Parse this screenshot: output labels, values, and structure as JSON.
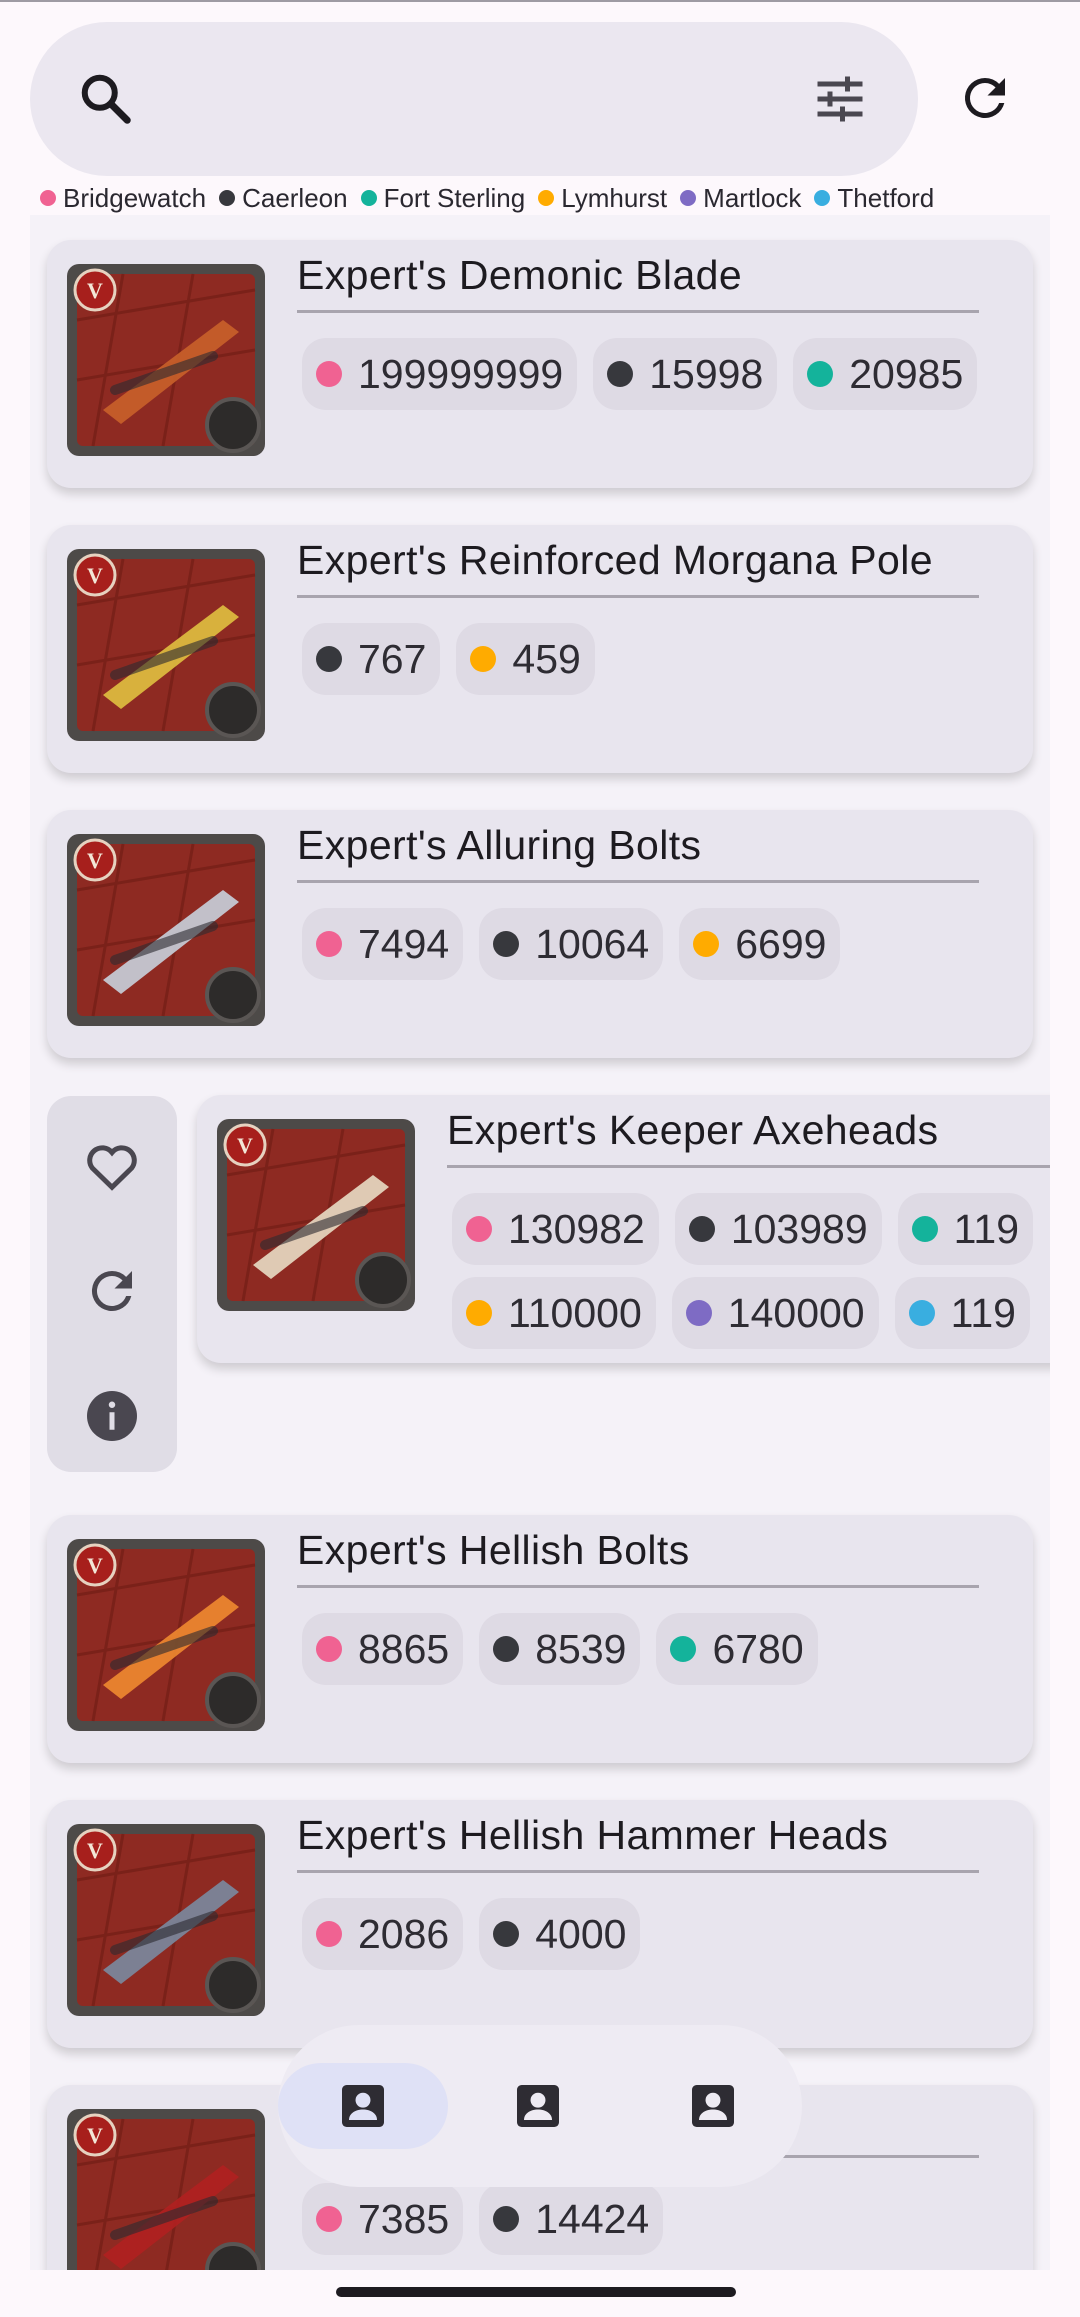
{
  "search": {
    "search_icon": "search-icon",
    "filter_icon": "tune-icon"
  },
  "header": {
    "refresh_icon": "refresh-icon"
  },
  "legend": [
    {
      "city": "Bridgewatch",
      "color": "#f06292"
    },
    {
      "city": "Caerleon",
      "color": "#37383d"
    },
    {
      "city": "Fort Sterling",
      "color": "#14b39b"
    },
    {
      "city": "Lymhurst",
      "color": "#ffab00"
    },
    {
      "city": "Martlock",
      "color": "#7e6bc4"
    },
    {
      "city": "Thetford",
      "color": "#39aee0"
    }
  ],
  "items": [
    {
      "name": "Expert's Demonic Blade",
      "prices": [
        {
          "city": "Bridgewatch",
          "value": "199999999"
        },
        {
          "city": "Caerleon",
          "value": "15998"
        },
        {
          "city": "Fort Sterling",
          "value": "20985"
        }
      ]
    },
    {
      "name": "Expert's Reinforced Morgana Pole",
      "prices": [
        {
          "city": "Caerleon",
          "value": "767"
        },
        {
          "city": "Lymhurst",
          "value": "459"
        }
      ]
    },
    {
      "name": "Expert's Alluring Bolts",
      "prices": [
        {
          "city": "Bridgewatch",
          "value": "7494"
        },
        {
          "city": "Caerleon",
          "value": "10064"
        },
        {
          "city": "Lymhurst",
          "value": "6699"
        }
      ]
    },
    {
      "name": "Expert's Keeper Axeheads",
      "prices": [
        {
          "city": "Bridgewatch",
          "value": "130982"
        },
        {
          "city": "Caerleon",
          "value": "103989"
        },
        {
          "city": "Fort Sterling",
          "value": "119"
        },
        {
          "city": "Lymhurst",
          "value": "110000"
        },
        {
          "city": "Martlock",
          "value": "140000"
        },
        {
          "city": "Thetford",
          "value": "119"
        }
      ]
    },
    {
      "name": "Expert's Hellish Bolts",
      "prices": [
        {
          "city": "Bridgewatch",
          "value": "8865"
        },
        {
          "city": "Caerleon",
          "value": "8539"
        },
        {
          "city": "Fort Sterling",
          "value": "6780"
        }
      ]
    },
    {
      "name": "Expert's Hellish Hammer Heads",
      "prices": [
        {
          "city": "Bridgewatch",
          "value": "2086"
        },
        {
          "city": "Caerleon",
          "value": "4000"
        }
      ]
    },
    {
      "name": "",
      "prices": [
        {
          "city": "Bridgewatch",
          "value": "7385"
        },
        {
          "city": "Caerleon",
          "value": "14424"
        }
      ]
    }
  ],
  "swipe_actions": {
    "favorite_icon": "heart-outline-icon",
    "refresh_icon": "refresh-icon",
    "info_icon": "info-icon"
  },
  "bottom_nav": {
    "tabs": [
      {
        "icon": "account-box-icon",
        "active": true
      },
      {
        "icon": "account-box-icon",
        "active": false
      },
      {
        "icon": "account-box-icon",
        "active": false
      }
    ]
  }
}
